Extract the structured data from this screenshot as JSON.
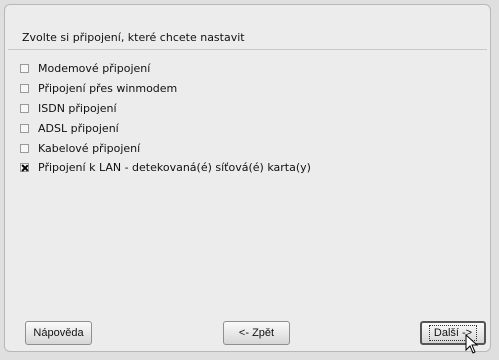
{
  "wizard": {
    "heading": "Zvolte si připojení, které chcete nastavit"
  },
  "options": [
    {
      "label": "Modemové připojení",
      "checked": false
    },
    {
      "label": "Připojení přes winmodem",
      "checked": false
    },
    {
      "label": "ISDN připojení",
      "checked": false
    },
    {
      "label": "ADSL připojení",
      "checked": false
    },
    {
      "label": "Kabelové připojení",
      "checked": false
    },
    {
      "label": "Připojení k LAN - detekovaná(é) síťová(é) karta(y)",
      "checked": true
    }
  ],
  "buttons": {
    "help_label": "Nápověda",
    "back_label": "<- Zpět",
    "next_label": "Další ->"
  },
  "icons": {
    "cursor": "mouse-pointer-icon"
  }
}
